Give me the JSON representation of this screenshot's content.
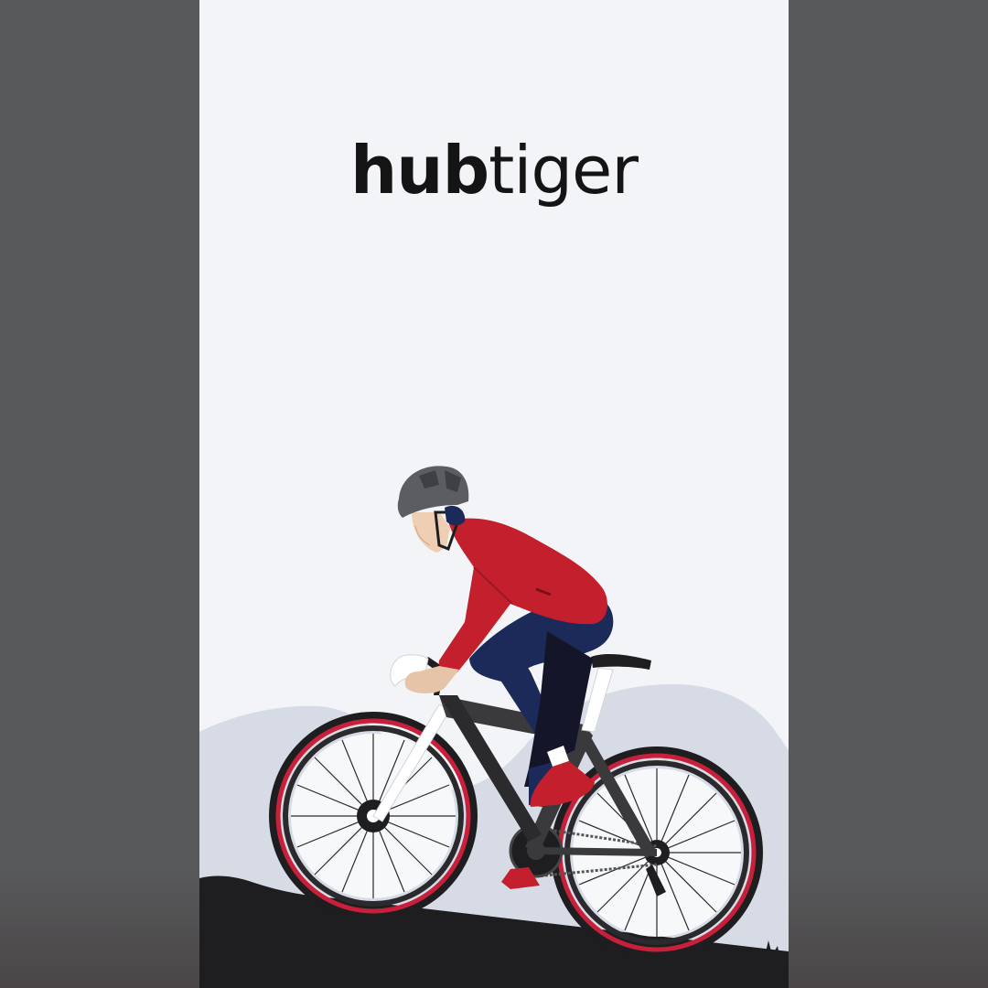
{
  "splash": {
    "brand_bold": "hub",
    "brand_light": "tiger"
  },
  "colors": {
    "background": "#f2f4f7",
    "hills": "#d6dbe6",
    "ground": "#1e1e20",
    "jersey": "#c41f2c",
    "pants": "#1c2a5a",
    "tire_accent": "#c8203a",
    "frame": "#3a3a3c",
    "fork": "#ffffff"
  },
  "icons": {
    "illustration": "cyclist-illustration"
  }
}
